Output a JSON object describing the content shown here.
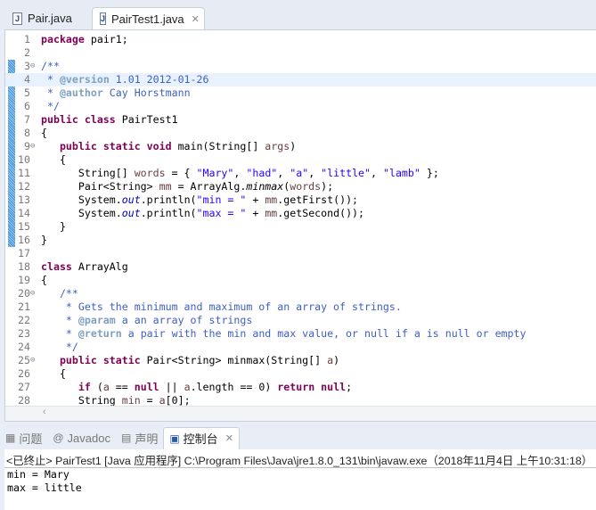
{
  "tabs": [
    {
      "label": "Pair.java",
      "icon": "java-file-icon"
    },
    {
      "label": "PairTest1.java",
      "icon": "java-file-icon",
      "close": "✕"
    }
  ],
  "code": [
    [
      [
        "kw",
        "package"
      ],
      [
        "pl",
        " pair1;"
      ]
    ],
    [],
    [
      [
        "cm",
        "/**"
      ]
    ],
    [
      [
        "cm",
        " * "
      ],
      [
        "tg",
        "@version"
      ],
      [
        "cm",
        " 1.01 2012-01-26"
      ]
    ],
    [
      [
        "cm",
        " * "
      ],
      [
        "tg",
        "@author"
      ],
      [
        "cm",
        " Cay Horstmann"
      ]
    ],
    [
      [
        "cm",
        " */"
      ]
    ],
    [
      [
        "kw",
        "public class"
      ],
      [
        "pl",
        " PairTest1"
      ]
    ],
    [
      [
        "pl",
        "{"
      ]
    ],
    [
      [
        "pl",
        "   "
      ],
      [
        "kw",
        "public static void"
      ],
      [
        "pl",
        " main(String[] "
      ],
      [
        "lv",
        "args"
      ],
      [
        "pl",
        ")"
      ]
    ],
    [
      [
        "pl",
        "   {"
      ]
    ],
    [
      [
        "pl",
        "      String[] "
      ],
      [
        "lv",
        "words"
      ],
      [
        "pl",
        " = { "
      ],
      [
        "st",
        "\"Mary\""
      ],
      [
        "pl",
        ", "
      ],
      [
        "st",
        "\"had\""
      ],
      [
        "pl",
        ", "
      ],
      [
        "st",
        "\"a\""
      ],
      [
        "pl",
        ", "
      ],
      [
        "st",
        "\"little\""
      ],
      [
        "pl",
        ", "
      ],
      [
        "st",
        "\"lamb\""
      ],
      [
        "pl",
        " };"
      ]
    ],
    [
      [
        "pl",
        "      Pair<String> "
      ],
      [
        "lv",
        "mm"
      ],
      [
        "pl",
        " = ArrayAlg."
      ],
      [
        "it",
        "minmax"
      ],
      [
        "pl",
        "("
      ],
      [
        "lv",
        "words"
      ],
      [
        "pl",
        ");"
      ]
    ],
    [
      [
        "pl",
        "      System."
      ],
      [
        "sf",
        "out"
      ],
      [
        "pl",
        ".println("
      ],
      [
        "st",
        "\"min = \""
      ],
      [
        "pl",
        " + "
      ],
      [
        "lv",
        "mm"
      ],
      [
        "pl",
        ".getFirst());"
      ]
    ],
    [
      [
        "pl",
        "      System."
      ],
      [
        "sf",
        "out"
      ],
      [
        "pl",
        ".println("
      ],
      [
        "st",
        "\"max = \""
      ],
      [
        "pl",
        " + "
      ],
      [
        "lv",
        "mm"
      ],
      [
        "pl",
        ".getSecond());"
      ]
    ],
    [
      [
        "pl",
        "   }"
      ]
    ],
    [
      [
        "pl",
        "}"
      ]
    ],
    [],
    [
      [
        "kw",
        "class"
      ],
      [
        "pl",
        " ArrayAlg"
      ]
    ],
    [
      [
        "pl",
        "{"
      ]
    ],
    [
      [
        "pl",
        "   "
      ],
      [
        "cm",
        "/**"
      ]
    ],
    [
      [
        "cm",
        "    * Gets the minimum and maximum of an array of strings."
      ]
    ],
    [
      [
        "cm",
        "    * "
      ],
      [
        "tg",
        "@param"
      ],
      [
        "cm",
        " a an array of strings"
      ]
    ],
    [
      [
        "cm",
        "    * "
      ],
      [
        "tg",
        "@return"
      ],
      [
        "cm",
        " a pair with the min and max value, or null if a is null or empty"
      ]
    ],
    [
      [
        "cm",
        "    */"
      ]
    ],
    [
      [
        "pl",
        "   "
      ],
      [
        "kw",
        "public static"
      ],
      [
        "pl",
        " Pair<String> minmax(String[] "
      ],
      [
        "lv",
        "a"
      ],
      [
        "pl",
        ")"
      ]
    ],
    [
      [
        "pl",
        "   {"
      ]
    ],
    [
      [
        "pl",
        "      "
      ],
      [
        "kw",
        "if"
      ],
      [
        "pl",
        " ("
      ],
      [
        "lv",
        "a"
      ],
      [
        "pl",
        " == "
      ],
      [
        "kw",
        "null"
      ],
      [
        "pl",
        " || "
      ],
      [
        "lv",
        "a"
      ],
      [
        "pl",
        ".length == 0) "
      ],
      [
        "kw",
        "return null"
      ],
      [
        "pl",
        ";"
      ]
    ],
    [
      [
        "pl",
        "      String "
      ],
      [
        "lv",
        "min"
      ],
      [
        "pl",
        " = "
      ],
      [
        "lv",
        "a"
      ],
      [
        "pl",
        "[0];"
      ]
    ]
  ],
  "fold_lines": [
    3,
    9,
    20,
    25
  ],
  "current_line": 4,
  "scroll_left": "‹",
  "views": [
    {
      "label": "问题",
      "icon": "problems-icon",
      "glyph": "▦"
    },
    {
      "label": "Javadoc",
      "icon": "javadoc-icon",
      "glyph": "@"
    },
    {
      "label": "声明",
      "icon": "declaration-icon",
      "glyph": "▤"
    },
    {
      "label": "控制台",
      "icon": "console-icon",
      "glyph": "▣",
      "close": "✕"
    }
  ],
  "console": {
    "header": "<已终止> PairTest1 [Java 应用程序] C:\\Program Files\\Java\\jre1.8.0_131\\bin\\javaw.exe（2018年11月4日 上午10:31:18）",
    "output": [
      "min = Mary",
      "max = little"
    ]
  }
}
